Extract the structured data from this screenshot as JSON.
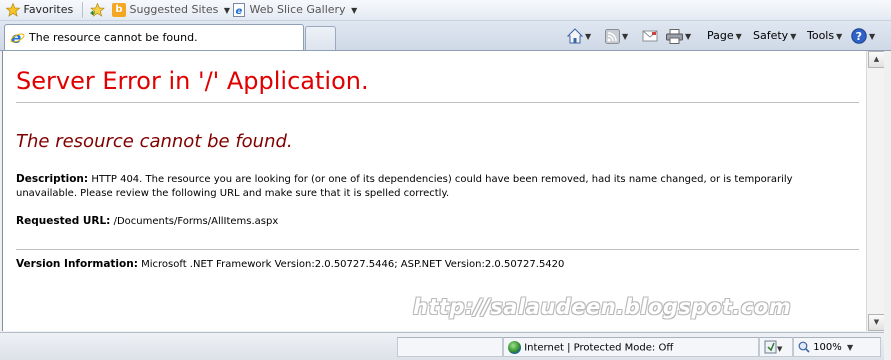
{
  "favorites_bar": {
    "favorites_label": "Favorites",
    "suggested_sites_label": "Suggested Sites",
    "web_slice_gallery_label": "Web Slice Gallery"
  },
  "tab": {
    "title": "The resource cannot be found."
  },
  "command_bar": {
    "page_label": "Page",
    "safety_label": "Safety",
    "tools_label": "Tools"
  },
  "page": {
    "heading": "Server Error in '/' Application.",
    "subheading": "The resource cannot be found.",
    "description_label": "Description:",
    "description_text": "HTTP 404. The resource you are looking for (or one of its dependencies) could have been removed, had its name changed, or is temporarily unavailable.  Please review the following URL and make sure that it is spelled correctly.",
    "requested_url_label": "Requested URL:",
    "requested_url_value": "/Documents/Forms/AllItems.aspx",
    "version_label": "Version Information:",
    "version_value": "Microsoft .NET Framework Version:2.0.50727.5446; ASP.NET Version:2.0.50727.5420",
    "watermark": "http://salaudeen.blogspot.com"
  },
  "status_bar": {
    "zone_text": "Internet | Protected Mode: Off",
    "zoom_text": "100%"
  },
  "colors": {
    "heading": "#e00000",
    "subheading": "#800000"
  }
}
